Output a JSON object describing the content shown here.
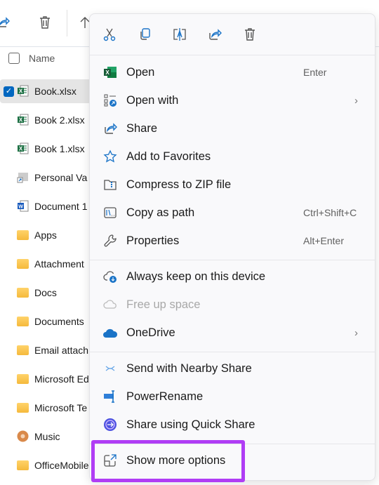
{
  "explorer": {
    "toolbar": [
      {
        "icon": "share-icon"
      },
      {
        "icon": "trash-icon"
      },
      {
        "icon": "arrow-up-icon"
      }
    ],
    "column_header": "Name",
    "files": [
      {
        "name": "Book.xlsx",
        "type": "excel",
        "selected": true
      },
      {
        "name": "Book 2.xlsx",
        "type": "excel"
      },
      {
        "name": "Book 1.xlsx",
        "type": "excel"
      },
      {
        "name": "Personal Va",
        "type": "shortcut"
      },
      {
        "name": "Document 1",
        "type": "word"
      },
      {
        "name": "Apps",
        "type": "folder"
      },
      {
        "name": "Attachment",
        "type": "folder"
      },
      {
        "name": "Docs",
        "type": "folder"
      },
      {
        "name": "Documents",
        "type": "folder"
      },
      {
        "name": "Email attach",
        "type": "folder"
      },
      {
        "name": "Microsoft Ed",
        "type": "folder"
      },
      {
        "name": "Microsoft Te",
        "type": "folder"
      },
      {
        "name": "Music",
        "type": "music"
      },
      {
        "name": "OfficeMobile",
        "type": "folder"
      }
    ]
  },
  "context_menu": {
    "quick_actions": [
      "cut-icon",
      "copy-icon",
      "rename-icon",
      "share-icon",
      "delete-icon"
    ],
    "groups": [
      [
        {
          "label": "Open",
          "shortcut": "Enter",
          "icon": "excel-icon"
        },
        {
          "label": "Open with",
          "submenu": true,
          "icon": "open-with-icon"
        },
        {
          "label": "Share",
          "icon": "share-icon"
        },
        {
          "label": "Add to Favorites",
          "icon": "star-icon"
        },
        {
          "label": "Compress to ZIP file",
          "icon": "zip-folder-icon"
        },
        {
          "label": "Copy as path",
          "shortcut": "Ctrl+Shift+C",
          "icon": "copy-path-icon"
        },
        {
          "label": "Properties",
          "shortcut": "Alt+Enter",
          "icon": "wrench-icon"
        }
      ],
      [
        {
          "label": "Always keep on this device",
          "icon": "cloud-download-icon"
        },
        {
          "label": "Free up space",
          "disabled": true,
          "icon": "cloud-icon"
        },
        {
          "label": "OneDrive",
          "submenu": true,
          "icon": "onedrive-icon"
        }
      ],
      [
        {
          "label": "Send with Nearby Share",
          "icon": "nearby-share-icon"
        },
        {
          "label": "PowerRename",
          "icon": "powerrename-icon"
        },
        {
          "label": "Share using Quick Share",
          "icon": "quick-share-icon"
        }
      ],
      [
        {
          "label": "Show more options",
          "icon": "show-more-icon",
          "highlighted": true
        }
      ]
    ]
  },
  "colors": {
    "accent": "#0067c0",
    "highlight": "#b03df5",
    "excel": "#1d7044"
  }
}
